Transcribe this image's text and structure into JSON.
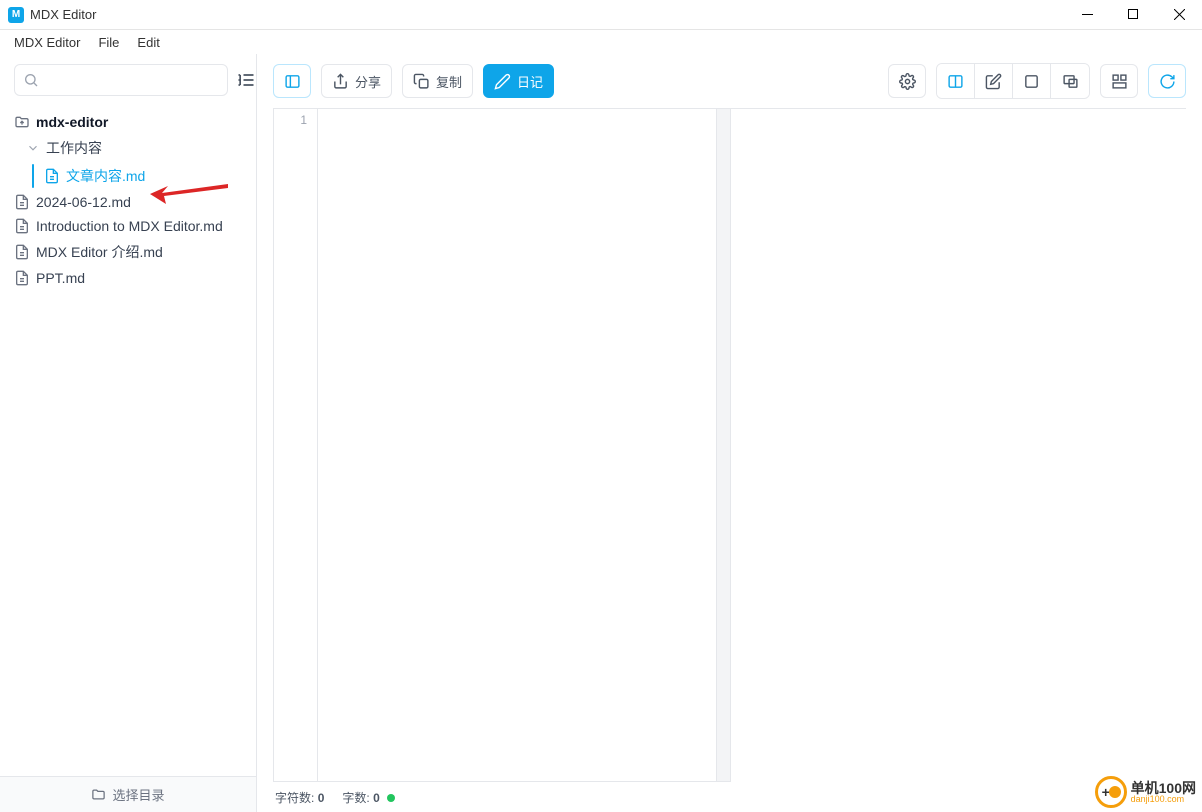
{
  "window": {
    "title": "MDX Editor"
  },
  "menubar": {
    "items": [
      "MDX Editor",
      "File",
      "Edit"
    ]
  },
  "sidebar": {
    "search_placeholder": "",
    "root": "mdx-editor",
    "folder": "工作内容",
    "selected_file": "文章内容.md",
    "files": [
      "2024-06-12.md",
      "Introduction to MDX Editor.md",
      "MDX Editor 介绍.md",
      "PPT.md"
    ],
    "footer": "选择目录"
  },
  "toolbar": {
    "share": "分享",
    "copy": "复制",
    "diary": "日记"
  },
  "editor": {
    "line_start": "1"
  },
  "statusbar": {
    "chars_label": "字符数:",
    "chars_value": "0",
    "words_label": "字数:",
    "words_value": "0"
  },
  "watermark": {
    "cn": "单机100网",
    "en": "danji100.com"
  }
}
